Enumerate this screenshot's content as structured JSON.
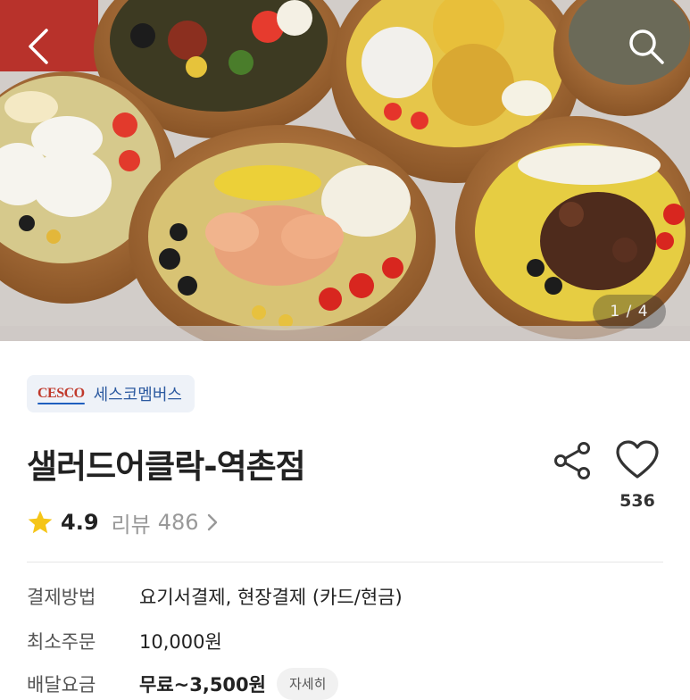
{
  "hero": {
    "pager_current": "1",
    "pager_separator": "/",
    "pager_total": "4",
    "icons": {
      "back": "chevron-left-icon",
      "search": "search-icon"
    }
  },
  "brand": {
    "logo_text": "CESCO",
    "name": "세스코멤버스",
    "colors": {
      "logo": "#c0392b",
      "name": "#2c5aa0",
      "badge_bg": "#eef2f8"
    }
  },
  "store": {
    "title": "샐러드어클락-역촌점",
    "like_count": "536",
    "icons": {
      "share": "share-icon",
      "like": "heart-icon"
    }
  },
  "rating": {
    "value": "4.9",
    "review_label": "리뷰",
    "review_count": "486",
    "star_color": "#f5c518",
    "icons": {
      "star": "star-icon",
      "more": "chevron-right-icon"
    }
  },
  "info": {
    "payment": {
      "label": "결제방법",
      "value": "요기서결제, 현장결제 (카드/현금)"
    },
    "min_order": {
      "label": "최소주문",
      "value": "10,000원"
    },
    "delivery_fee": {
      "label": "배달요금",
      "value": "무료~3,500원",
      "detail_button": "자세히"
    }
  }
}
